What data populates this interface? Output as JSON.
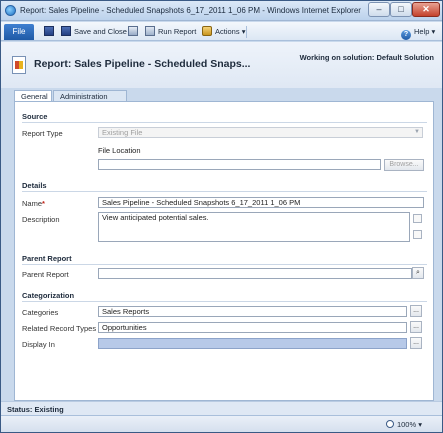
{
  "window": {
    "title": "Report: Sales Pipeline - Scheduled Snapshots 6_17_2011 1_06 PM - Windows Internet Explorer",
    "minimize": "–",
    "maximize": "□",
    "close": "✕",
    "icon": "ie-icon"
  },
  "ribbon": {
    "file_label": "File",
    "save_icon": "save-icon",
    "save_close_label": "Save and Close",
    "run_report_label": "Run Report",
    "actions_label": "Actions",
    "help_label": "Help"
  },
  "header": {
    "title": "Report: Sales Pipeline - Scheduled Snaps...",
    "solution": "Working on solution: Default Solution"
  },
  "tabs": [
    "General",
    "Administration"
  ],
  "form": {
    "source": {
      "heading": "Source",
      "report_type_label": "Report Type",
      "report_type_value": "Existing File",
      "file_location_label": "File Location",
      "file_location_value": "",
      "browse_label": "Browse..."
    },
    "details": {
      "heading": "Details",
      "name_label": "Name",
      "name_required": "*",
      "name_value": "Sales Pipeline - Scheduled Snapshots 6_17_2011 1_06 PM",
      "description_label": "Description",
      "description_value": "View anticipated potential sales."
    },
    "parent": {
      "heading": "Parent Report",
      "parent_label": "Parent Report",
      "parent_value": ""
    },
    "categorization": {
      "heading": "Categorization",
      "categories_label": "Categories",
      "categories_value": "Sales Reports",
      "related_label": "Related Record Types",
      "related_value": "Opportunities",
      "display_label": "Display In",
      "display_value": "",
      "ellipsis": "..."
    }
  },
  "status": {
    "label": "Status: Existing"
  },
  "statusbar": {
    "zoom": "100%"
  },
  "colors": {
    "accent": "#1f5aa6",
    "required": "#c0271b",
    "display_in_fill": "#b7c9e8"
  }
}
